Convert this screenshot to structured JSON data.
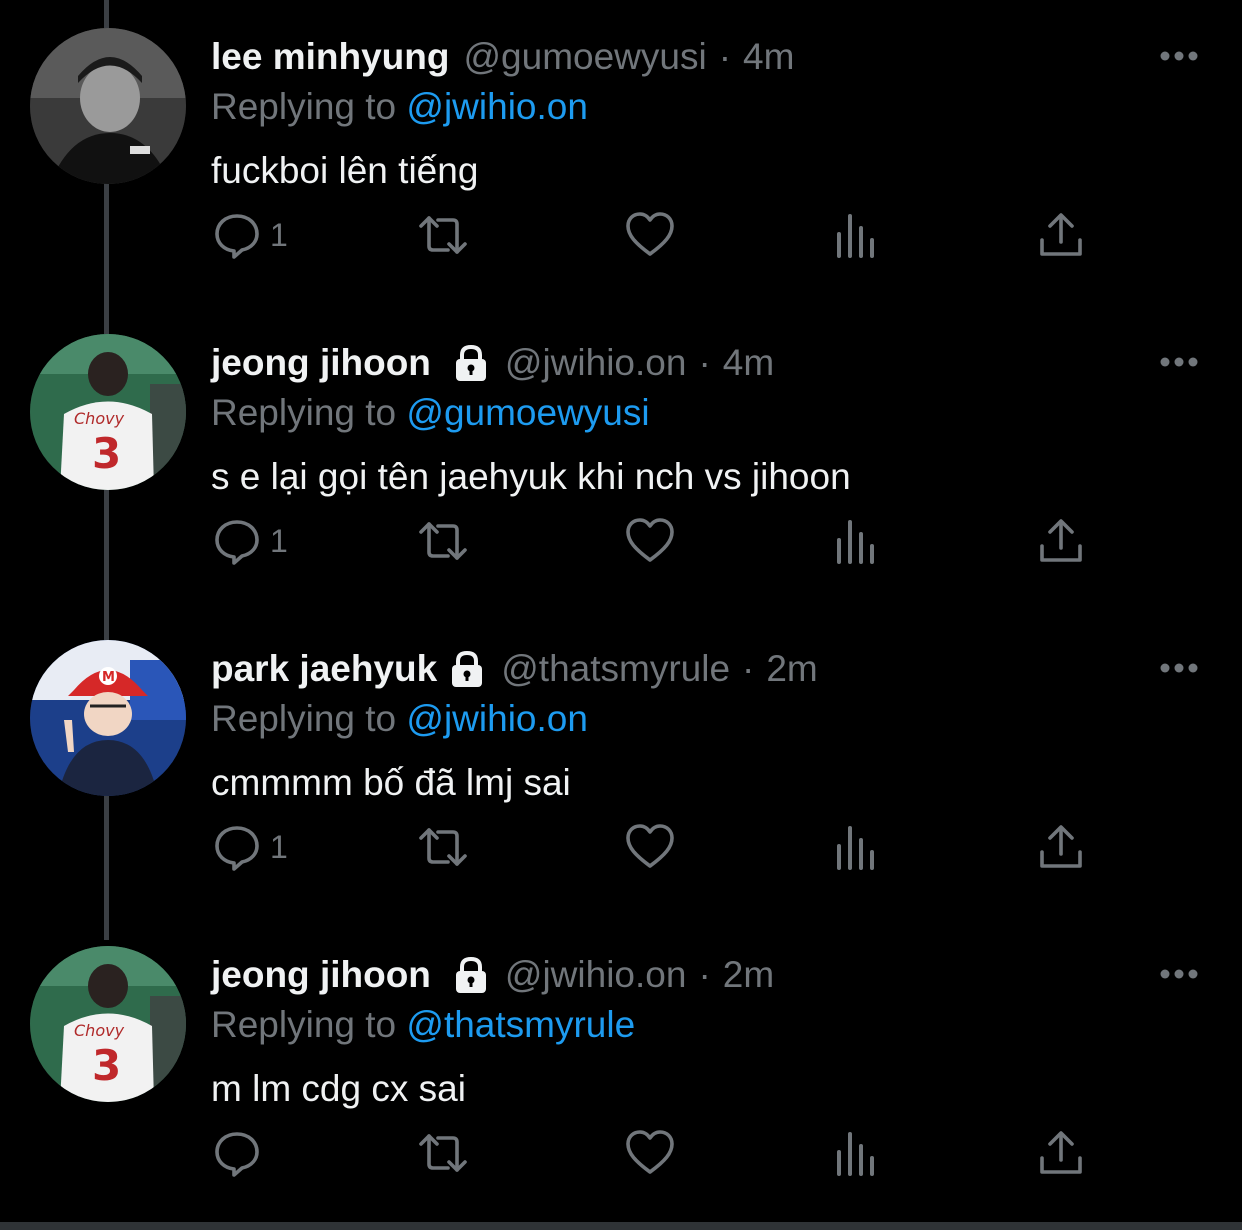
{
  "colors": {
    "background": "#000000",
    "accent": "#1d9bf0",
    "muted": "#71767b",
    "text": "#e7e9ea"
  },
  "icons": {
    "more": "more-horizontal-icon",
    "reply": "reply-bubble-icon",
    "retweet": "retweet-icon",
    "like": "heart-icon",
    "views": "bar-chart-icon",
    "share": "share-icon",
    "protected": "lock-icon"
  },
  "tweets": [
    {
      "name": "lee minhyung",
      "handle": "@gumoewyusi",
      "separator": "·",
      "time": "4m",
      "protected": false,
      "replying_prefix": "Replying to",
      "replying_to": "@jwihio.on",
      "text": "fuckboi lên tiếng",
      "reply_count": "1"
    },
    {
      "name": "jeong jihoon",
      "handle": "@jwihio.on",
      "separator": "·",
      "time": "4m",
      "protected": true,
      "replying_prefix": "Replying to",
      "replying_to": "@gumoewyusi",
      "text": "s e lại gọi tên jaehyuk khi nch vs jihoon",
      "reply_count": "1"
    },
    {
      "name": "park jaehyuk",
      "handle": "@thatsmyrule",
      "separator": "·",
      "time": "2m",
      "protected": true,
      "replying_prefix": "Replying to",
      "replying_to": "@jwihio.on",
      "text": "cmmmm bố đã lmj sai",
      "reply_count": "1"
    },
    {
      "name": "jeong jihoon",
      "handle": "@jwihio.on",
      "separator": "·",
      "time": "2m",
      "protected": true,
      "replying_prefix": "Replying to",
      "replying_to": "@thatsmyrule",
      "text": "m lm cdg cx sai",
      "reply_count": ""
    }
  ]
}
